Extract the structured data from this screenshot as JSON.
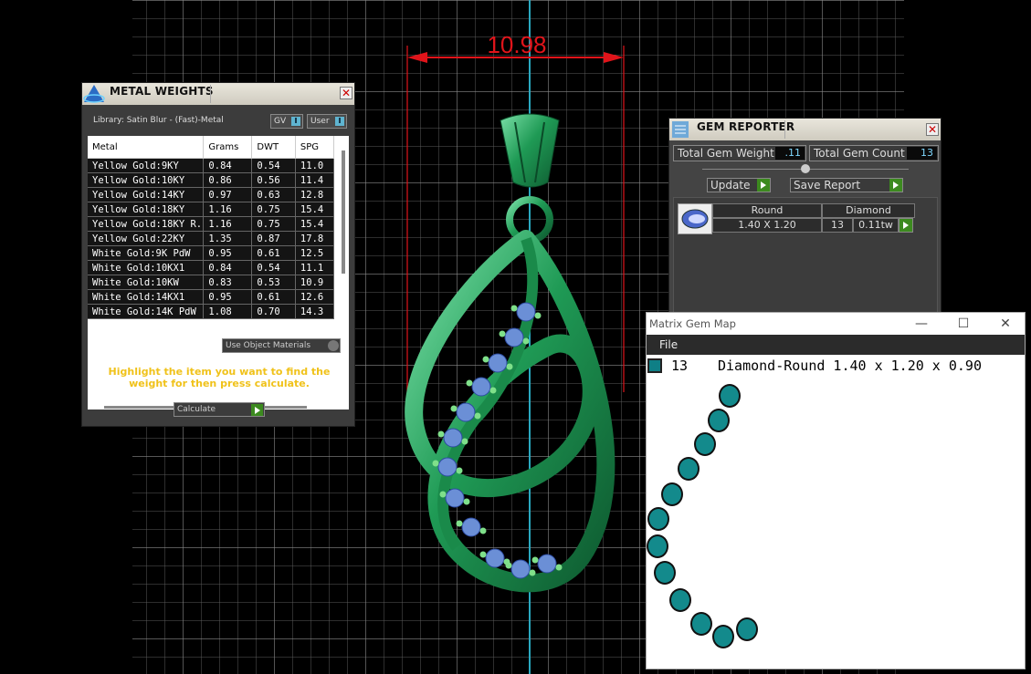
{
  "dimension": "10.98",
  "metal_weights": {
    "title": "METAL WEIGHTS",
    "library": "Library: Satin Blur - (Fast)-Metal",
    "gv_label": "GV",
    "user_label": "User",
    "toggle_mark": "I",
    "columns": [
      "Metal",
      "Grams",
      "DWT",
      "SPG"
    ],
    "rows": [
      [
        "Yellow Gold:9KY",
        "0.84",
        "0.54",
        "11.0"
      ],
      [
        "Yellow Gold:10KY",
        "0.86",
        "0.56",
        "11.4"
      ],
      [
        "Yellow Gold:14KY",
        "0.97",
        "0.63",
        "12.8"
      ],
      [
        "Yellow Gold:18KY",
        "1.16",
        "0.75",
        "15.4"
      ],
      [
        "Yellow Gold:18KY R...",
        "1.16",
        "0.75",
        "15.4"
      ],
      [
        "Yellow Gold:22KY",
        "1.35",
        "0.87",
        "17.8"
      ],
      [
        "White Gold:9K PdW",
        "0.95",
        "0.61",
        "12.5"
      ],
      [
        "White Gold:10KX1",
        "0.84",
        "0.54",
        "11.1"
      ],
      [
        "White Gold:10KW",
        "0.83",
        "0.53",
        "10.9"
      ],
      [
        "White Gold:14KX1",
        "0.95",
        "0.61",
        "12.6"
      ],
      [
        "White Gold:14K PdW",
        "1.08",
        "0.70",
        "14.3"
      ]
    ],
    "use_object_materials": "Use Object Materials",
    "hint": "Highlight the item you want to find the weight for then press calculate.",
    "calculate": "Calculate"
  },
  "gem_reporter": {
    "title": "GEM REPORTER",
    "total_weight_label": "Total Gem Weight",
    "total_weight": ".11",
    "total_count_label": "Total Gem Count",
    "total_count": "13",
    "update": "Update",
    "save_report": "Save Report",
    "shape": "Round",
    "size": "1.40 X 1.20",
    "stone": "Diamond",
    "count": "13",
    "weight": "0.11tw"
  },
  "gem_map": {
    "title": "Matrix Gem Map",
    "menu_file": "File",
    "count": "13",
    "description": "Diamond-Round 1.40 x 1.20 x 0.90",
    "swatch_color": "#0f7f86",
    "window_controls": [
      "—",
      "☐",
      "✕"
    ]
  },
  "colors": {
    "metal": "#1f9a55",
    "stone": "#6b8fd6",
    "dimension": "#e0141a",
    "axis": "#2aa8c0"
  }
}
